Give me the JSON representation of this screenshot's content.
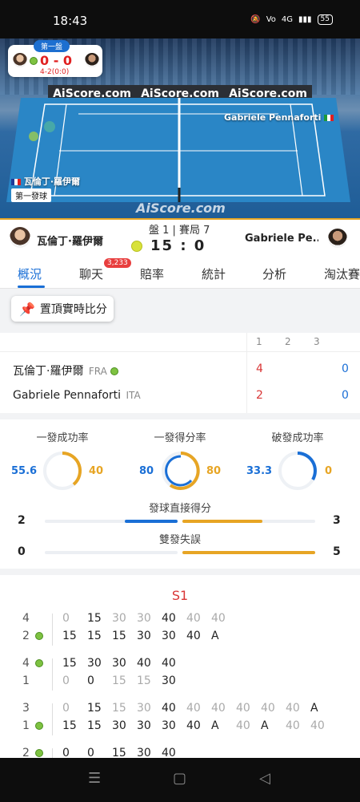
{
  "status": {
    "time": "18:43",
    "battery": "55",
    "net": "4G"
  },
  "hero": {
    "set_tag": "第一盤",
    "mini_points": "0 - 0",
    "mini_games": "4-2(0:0)",
    "ad1": "AiScore.com",
    "ad2": "AiScore.com",
    "ad3": "AiScore.com",
    "watermark": "AiScore.com",
    "player_far": "Gabriele Pennaforti",
    "player_near": "瓦倫丁·羅伊爾",
    "serve_label": "第一發球"
  },
  "scorebar": {
    "player1": "瓦倫丁·羅伊爾",
    "player2": "Gabriele Pe...",
    "game_label": "盤 1 | 賽局 7",
    "points": "15 : 0"
  },
  "tabs": [
    "概況",
    "聊天",
    "賠率",
    "統計",
    "分析",
    "淘汰賽"
  ],
  "chat_badge": "3,233",
  "pin_label": "置頂實時比分",
  "sets": {
    "headers": [
      "1",
      "2",
      "3"
    ],
    "p1": {
      "name": "瓦倫丁·羅伊爾",
      "country": "FRA",
      "set1": "4",
      "total": "0"
    },
    "p2": {
      "name": "Gabriele Pennaforti",
      "country": "ITA",
      "set1": "2",
      "total": "0"
    }
  },
  "stats": {
    "first_serve": {
      "title": "一發成功率",
      "left": "55.6",
      "right": "40"
    },
    "first_serve_won": {
      "title": "一發得分率",
      "left": "80",
      "right": "80"
    },
    "break_points": {
      "title": "破發成功率",
      "left": "33.3",
      "right": "0"
    },
    "aces": {
      "title": "發球直接得分",
      "left": "2",
      "right": "3",
      "left_share": 0.4,
      "right_share": 0.6
    },
    "double_faults": {
      "title": "雙發失誤",
      "left": "0",
      "right": "5",
      "left_share": 0.0,
      "right_share": 1.0
    }
  },
  "colors": {
    "accent_blue": "#1a6fd6",
    "accent_orange": "#e7a524",
    "accent_red": "#d93636"
  },
  "pbp": {
    "set_label": "S1",
    "games": [
      {
        "top_score": "4",
        "bottom_score": "2",
        "server": "bottom",
        "top": [
          "0",
          "15",
          "30",
          "30",
          "40",
          "40",
          "40"
        ],
        "bottom": [
          "15",
          "15",
          "15",
          "30",
          "30",
          "40",
          "A"
        ]
      },
      {
        "top_score": "4",
        "bottom_score": "1",
        "server": "top",
        "top": [
          "15",
          "30",
          "30",
          "40",
          "40"
        ],
        "bottom": [
          "0",
          "0",
          "15",
          "15",
          "30"
        ]
      },
      {
        "top_score": "3",
        "bottom_score": "1",
        "server": "bottom",
        "top": [
          "0",
          "15",
          "15",
          "30",
          "40",
          "40",
          "40",
          "40",
          "40",
          "40",
          "A"
        ],
        "bottom": [
          "15",
          "15",
          "30",
          "30",
          "30",
          "40",
          "A",
          "40",
          "A",
          "40",
          "40"
        ]
      },
      {
        "top_score": "2",
        "bottom_score": "",
        "server": "top",
        "top": [
          "0",
          "0",
          "15",
          "30",
          "40"
        ],
        "bottom": []
      }
    ]
  }
}
